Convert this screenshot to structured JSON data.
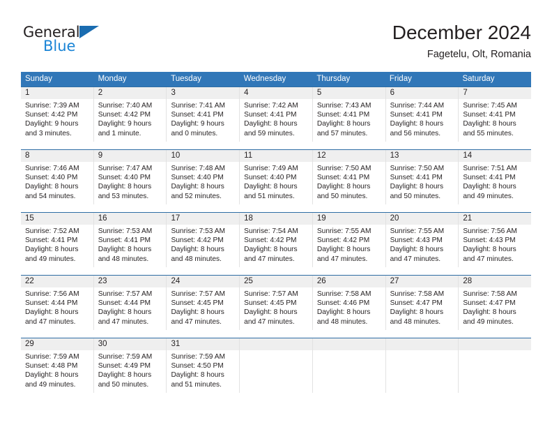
{
  "brand": {
    "name_part1": "General",
    "name_part2": "Blue",
    "triangle_icon": "triangle-icon",
    "colors": {
      "dark": "#231f20",
      "blue": "#1a84d6",
      "triangle": "#1a6cb0"
    }
  },
  "header": {
    "title": "December 2024",
    "location": "Fagetelu, Olt, Romania"
  },
  "theme": {
    "header_row_bg": "#3177b8",
    "header_row_text": "#ffffff",
    "day_number_bg": "#efefef",
    "week_divider": "#2e6da4",
    "cell_border": "#e2e2e2"
  },
  "weekdays": [
    "Sunday",
    "Monday",
    "Tuesday",
    "Wednesday",
    "Thursday",
    "Friday",
    "Saturday"
  ],
  "weeks": [
    [
      {
        "day": "1",
        "sunrise": "Sunrise: 7:39 AM",
        "sunset": "Sunset: 4:42 PM",
        "daylight_line1": "Daylight: 9 hours",
        "daylight_line2": "and 3 minutes."
      },
      {
        "day": "2",
        "sunrise": "Sunrise: 7:40 AM",
        "sunset": "Sunset: 4:42 PM",
        "daylight_line1": "Daylight: 9 hours",
        "daylight_line2": "and 1 minute."
      },
      {
        "day": "3",
        "sunrise": "Sunrise: 7:41 AM",
        "sunset": "Sunset: 4:41 PM",
        "daylight_line1": "Daylight: 9 hours",
        "daylight_line2": "and 0 minutes."
      },
      {
        "day": "4",
        "sunrise": "Sunrise: 7:42 AM",
        "sunset": "Sunset: 4:41 PM",
        "daylight_line1": "Daylight: 8 hours",
        "daylight_line2": "and 59 minutes."
      },
      {
        "day": "5",
        "sunrise": "Sunrise: 7:43 AM",
        "sunset": "Sunset: 4:41 PM",
        "daylight_line1": "Daylight: 8 hours",
        "daylight_line2": "and 57 minutes."
      },
      {
        "day": "6",
        "sunrise": "Sunrise: 7:44 AM",
        "sunset": "Sunset: 4:41 PM",
        "daylight_line1": "Daylight: 8 hours",
        "daylight_line2": "and 56 minutes."
      },
      {
        "day": "7",
        "sunrise": "Sunrise: 7:45 AM",
        "sunset": "Sunset: 4:41 PM",
        "daylight_line1": "Daylight: 8 hours",
        "daylight_line2": "and 55 minutes."
      }
    ],
    [
      {
        "day": "8",
        "sunrise": "Sunrise: 7:46 AM",
        "sunset": "Sunset: 4:40 PM",
        "daylight_line1": "Daylight: 8 hours",
        "daylight_line2": "and 54 minutes."
      },
      {
        "day": "9",
        "sunrise": "Sunrise: 7:47 AM",
        "sunset": "Sunset: 4:40 PM",
        "daylight_line1": "Daylight: 8 hours",
        "daylight_line2": "and 53 minutes."
      },
      {
        "day": "10",
        "sunrise": "Sunrise: 7:48 AM",
        "sunset": "Sunset: 4:40 PM",
        "daylight_line1": "Daylight: 8 hours",
        "daylight_line2": "and 52 minutes."
      },
      {
        "day": "11",
        "sunrise": "Sunrise: 7:49 AM",
        "sunset": "Sunset: 4:40 PM",
        "daylight_line1": "Daylight: 8 hours",
        "daylight_line2": "and 51 minutes."
      },
      {
        "day": "12",
        "sunrise": "Sunrise: 7:50 AM",
        "sunset": "Sunset: 4:41 PM",
        "daylight_line1": "Daylight: 8 hours",
        "daylight_line2": "and 50 minutes."
      },
      {
        "day": "13",
        "sunrise": "Sunrise: 7:50 AM",
        "sunset": "Sunset: 4:41 PM",
        "daylight_line1": "Daylight: 8 hours",
        "daylight_line2": "and 50 minutes."
      },
      {
        "day": "14",
        "sunrise": "Sunrise: 7:51 AM",
        "sunset": "Sunset: 4:41 PM",
        "daylight_line1": "Daylight: 8 hours",
        "daylight_line2": "and 49 minutes."
      }
    ],
    [
      {
        "day": "15",
        "sunrise": "Sunrise: 7:52 AM",
        "sunset": "Sunset: 4:41 PM",
        "daylight_line1": "Daylight: 8 hours",
        "daylight_line2": "and 49 minutes."
      },
      {
        "day": "16",
        "sunrise": "Sunrise: 7:53 AM",
        "sunset": "Sunset: 4:41 PM",
        "daylight_line1": "Daylight: 8 hours",
        "daylight_line2": "and 48 minutes."
      },
      {
        "day": "17",
        "sunrise": "Sunrise: 7:53 AM",
        "sunset": "Sunset: 4:42 PM",
        "daylight_line1": "Daylight: 8 hours",
        "daylight_line2": "and 48 minutes."
      },
      {
        "day": "18",
        "sunrise": "Sunrise: 7:54 AM",
        "sunset": "Sunset: 4:42 PM",
        "daylight_line1": "Daylight: 8 hours",
        "daylight_line2": "and 47 minutes."
      },
      {
        "day": "19",
        "sunrise": "Sunrise: 7:55 AM",
        "sunset": "Sunset: 4:42 PM",
        "daylight_line1": "Daylight: 8 hours",
        "daylight_line2": "and 47 minutes."
      },
      {
        "day": "20",
        "sunrise": "Sunrise: 7:55 AM",
        "sunset": "Sunset: 4:43 PM",
        "daylight_line1": "Daylight: 8 hours",
        "daylight_line2": "and 47 minutes."
      },
      {
        "day": "21",
        "sunrise": "Sunrise: 7:56 AM",
        "sunset": "Sunset: 4:43 PM",
        "daylight_line1": "Daylight: 8 hours",
        "daylight_line2": "and 47 minutes."
      }
    ],
    [
      {
        "day": "22",
        "sunrise": "Sunrise: 7:56 AM",
        "sunset": "Sunset: 4:44 PM",
        "daylight_line1": "Daylight: 8 hours",
        "daylight_line2": "and 47 minutes."
      },
      {
        "day": "23",
        "sunrise": "Sunrise: 7:57 AM",
        "sunset": "Sunset: 4:44 PM",
        "daylight_line1": "Daylight: 8 hours",
        "daylight_line2": "and 47 minutes."
      },
      {
        "day": "24",
        "sunrise": "Sunrise: 7:57 AM",
        "sunset": "Sunset: 4:45 PM",
        "daylight_line1": "Daylight: 8 hours",
        "daylight_line2": "and 47 minutes."
      },
      {
        "day": "25",
        "sunrise": "Sunrise: 7:57 AM",
        "sunset": "Sunset: 4:45 PM",
        "daylight_line1": "Daylight: 8 hours",
        "daylight_line2": "and 47 minutes."
      },
      {
        "day": "26",
        "sunrise": "Sunrise: 7:58 AM",
        "sunset": "Sunset: 4:46 PM",
        "daylight_line1": "Daylight: 8 hours",
        "daylight_line2": "and 48 minutes."
      },
      {
        "day": "27",
        "sunrise": "Sunrise: 7:58 AM",
        "sunset": "Sunset: 4:47 PM",
        "daylight_line1": "Daylight: 8 hours",
        "daylight_line2": "and 48 minutes."
      },
      {
        "day": "28",
        "sunrise": "Sunrise: 7:58 AM",
        "sunset": "Sunset: 4:47 PM",
        "daylight_line1": "Daylight: 8 hours",
        "daylight_line2": "and 49 minutes."
      }
    ],
    [
      {
        "day": "29",
        "sunrise": "Sunrise: 7:59 AM",
        "sunset": "Sunset: 4:48 PM",
        "daylight_line1": "Daylight: 8 hours",
        "daylight_line2": "and 49 minutes."
      },
      {
        "day": "30",
        "sunrise": "Sunrise: 7:59 AM",
        "sunset": "Sunset: 4:49 PM",
        "daylight_line1": "Daylight: 8 hours",
        "daylight_line2": "and 50 minutes."
      },
      {
        "day": "31",
        "sunrise": "Sunrise: 7:59 AM",
        "sunset": "Sunset: 4:50 PM",
        "daylight_line1": "Daylight: 8 hours",
        "daylight_line2": "and 51 minutes."
      },
      {
        "day": "",
        "sunrise": "",
        "sunset": "",
        "daylight_line1": "",
        "daylight_line2": ""
      },
      {
        "day": "",
        "sunrise": "",
        "sunset": "",
        "daylight_line1": "",
        "daylight_line2": ""
      },
      {
        "day": "",
        "sunrise": "",
        "sunset": "",
        "daylight_line1": "",
        "daylight_line2": ""
      },
      {
        "day": "",
        "sunrise": "",
        "sunset": "",
        "daylight_line1": "",
        "daylight_line2": ""
      }
    ]
  ]
}
